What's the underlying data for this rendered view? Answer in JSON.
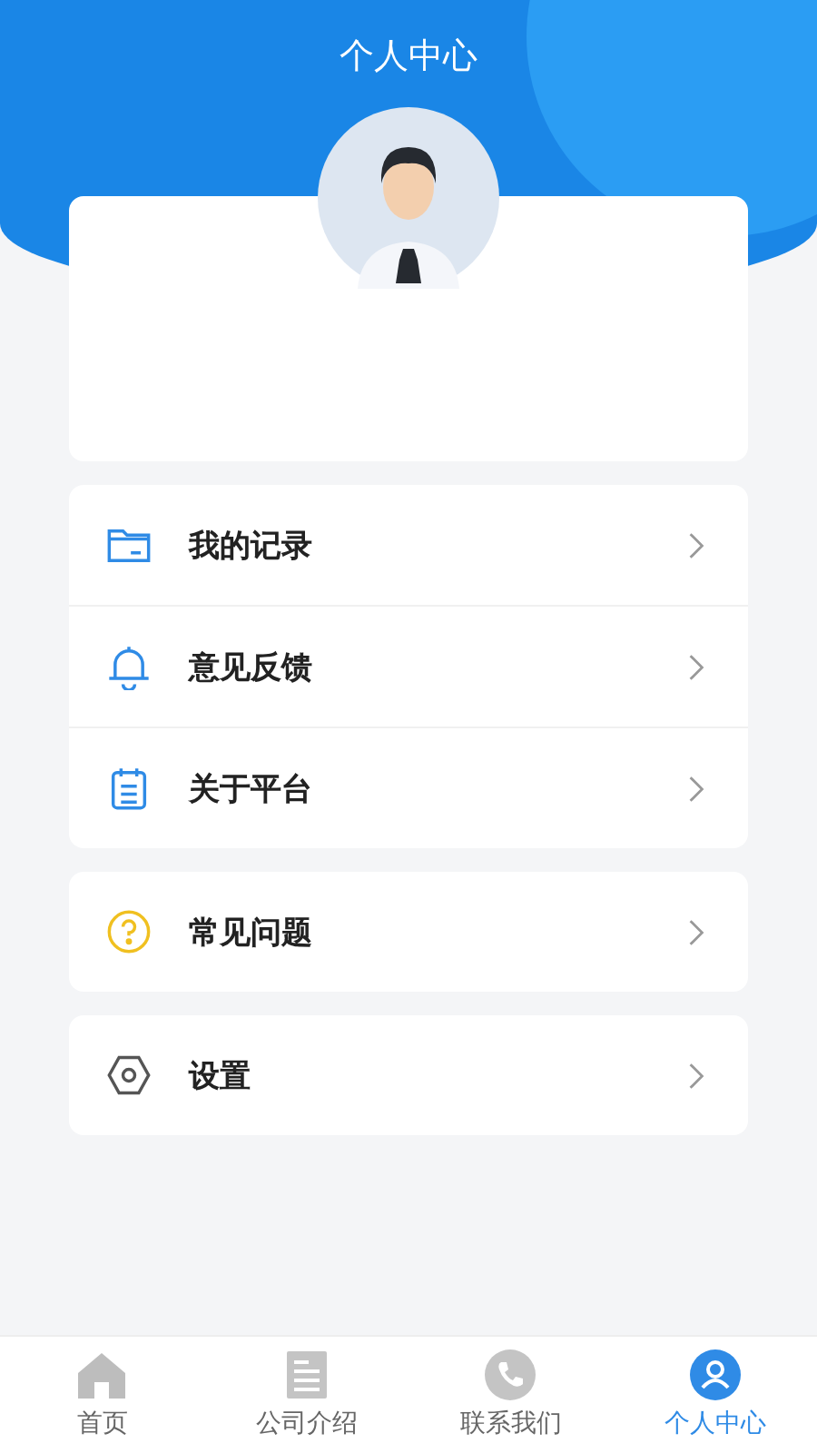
{
  "header": {
    "title": "个人中心"
  },
  "menu_groups": [
    {
      "items": [
        {
          "label": "我的记录",
          "kind": "folder"
        },
        {
          "label": "意见反馈",
          "kind": "bell"
        },
        {
          "label": "关于平台",
          "kind": "clipboard"
        }
      ]
    },
    {
      "items": [
        {
          "label": "常见问题",
          "kind": "question"
        }
      ]
    },
    {
      "items": [
        {
          "label": "设置",
          "kind": "settings"
        }
      ]
    }
  ],
  "tabs": [
    {
      "label": "首页",
      "kind": "home",
      "selected": false
    },
    {
      "label": "公司介绍",
      "kind": "document",
      "selected": false
    },
    {
      "label": "联系我们",
      "kind": "phone",
      "selected": false
    },
    {
      "label": "个人中心",
      "kind": "person",
      "selected": true
    }
  ]
}
